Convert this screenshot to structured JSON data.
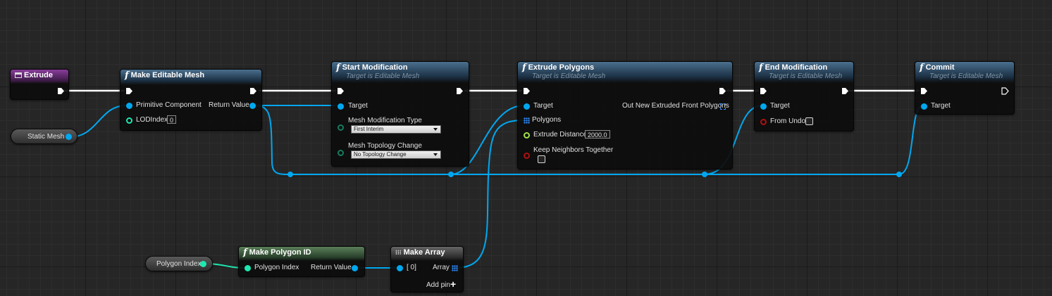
{
  "colors": {
    "exec_wire": "#ffffff",
    "object_wire": "#00a8f0",
    "struct_wire": "#1de8b0",
    "func_header": "#3f6482",
    "event_header": "#8a3d9c",
    "pure_header": "#5a7f59"
  },
  "event_node": {
    "title": "Extrude",
    "icon": "event-icon"
  },
  "static_mesh_var": {
    "label": "Static Mesh"
  },
  "polygon_index_var": {
    "label": "Polygon Index"
  },
  "make_editable_mesh": {
    "title": "Make Editable Mesh",
    "icon": "function-icon",
    "pins": {
      "primitive_component": "Primitive Component",
      "lod_index": "LODIndex",
      "lod_value": "0",
      "return_value": "Return Value"
    }
  },
  "start_modification": {
    "title": "Start Modification",
    "subtitle": "Target is Editable Mesh",
    "icon": "function-icon",
    "pins": {
      "target": "Target",
      "mesh_modification_type": "Mesh Modification Type",
      "mesh_modification_value": "First Interim",
      "mesh_topology_change": "Mesh Topology Change",
      "mesh_topology_value": "No Topology Change"
    }
  },
  "extrude_polygons": {
    "title": "Extrude Polygons",
    "subtitle": "Target is Editable Mesh",
    "icon": "function-icon",
    "pins": {
      "target": "Target",
      "polygons": "Polygons",
      "extrude_distance": "Extrude Distance",
      "extrude_distance_value": "2000.0",
      "keep_neighbors": "Keep Neighbors Together",
      "out_new": "Out New Extruded Front Polygons"
    }
  },
  "end_modification": {
    "title": "End Modification",
    "subtitle": "Target is Editable Mesh",
    "icon": "function-icon",
    "pins": {
      "target": "Target",
      "from_undo": "From Undo"
    }
  },
  "commit": {
    "title": "Commit",
    "subtitle": "Target is Editable Mesh",
    "icon": "function-icon",
    "pins": {
      "target": "Target"
    }
  },
  "make_polygon_id": {
    "title": "Make Polygon ID",
    "icon": "function-icon",
    "pins": {
      "polygon_index": "Polygon Index",
      "return_value": "Return Value"
    }
  },
  "make_array": {
    "title": "Make Array",
    "icon": "array-icon",
    "pins": {
      "item0": "[ 0]",
      "array": "Array",
      "add_pin": "Add pin"
    }
  }
}
